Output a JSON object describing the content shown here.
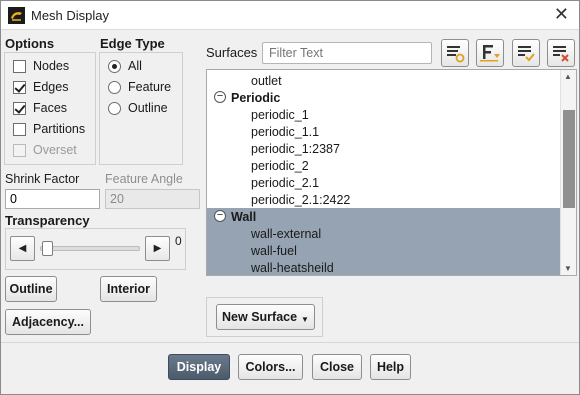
{
  "window": {
    "title": "Mesh Display",
    "close_glyph": "✕"
  },
  "options": {
    "label": "Options",
    "items": [
      {
        "label": "Nodes",
        "checked": false,
        "disabled": false
      },
      {
        "label": "Edges",
        "checked": true,
        "disabled": false
      },
      {
        "label": "Faces",
        "checked": true,
        "disabled": false
      },
      {
        "label": "Partitions",
        "checked": false,
        "disabled": false
      },
      {
        "label": "Overset",
        "checked": false,
        "disabled": true
      }
    ]
  },
  "edge_type": {
    "label": "Edge Type",
    "items": [
      {
        "label": "All",
        "selected": true
      },
      {
        "label": "Feature",
        "selected": false
      },
      {
        "label": "Outline",
        "selected": false
      }
    ]
  },
  "shrink_factor": {
    "label": "Shrink Factor",
    "value": "0"
  },
  "feature_angle": {
    "label": "Feature Angle",
    "value": "20"
  },
  "transparency": {
    "label": "Transparency",
    "value": "0",
    "left_glyph": "◀",
    "right_glyph": "▶",
    "fraction": 0
  },
  "buttons": {
    "outline": "Outline",
    "interior": "Interior",
    "adjacency": "Adjacency...",
    "new_surface": "New Surface",
    "display": "Display",
    "colors": "Colors...",
    "close": "Close",
    "help": "Help"
  },
  "surfaces": {
    "label": "Surfaces",
    "filter_placeholder": "Filter Text",
    "collapse_glyph": "−",
    "scroll_up_glyph": "▲",
    "scroll_down_glyph": "▼",
    "list": [
      {
        "kind": "item",
        "text": "outlet",
        "selected": false
      },
      {
        "kind": "group",
        "text": "Periodic",
        "selected": false
      },
      {
        "kind": "item",
        "text": "periodic_1",
        "selected": false
      },
      {
        "kind": "item",
        "text": "periodic_1.1",
        "selected": false
      },
      {
        "kind": "item",
        "text": "periodic_1:2387",
        "selected": false
      },
      {
        "kind": "item",
        "text": "periodic_2",
        "selected": false
      },
      {
        "kind": "item",
        "text": "periodic_2.1",
        "selected": false
      },
      {
        "kind": "item",
        "text": "periodic_2.1:2422",
        "selected": false
      },
      {
        "kind": "group",
        "text": "Wall",
        "selected": true
      },
      {
        "kind": "item",
        "text": "wall-external",
        "selected": true
      },
      {
        "kind": "item",
        "text": "wall-fuel",
        "selected": true
      },
      {
        "kind": "item",
        "text": "wall-heatsheild",
        "selected": true
      }
    ]
  },
  "colors": {
    "selection": "#95a3b2",
    "primary_button": "#56657a",
    "check_accent": "#e0a020",
    "deselect_accent": "#d05030"
  }
}
